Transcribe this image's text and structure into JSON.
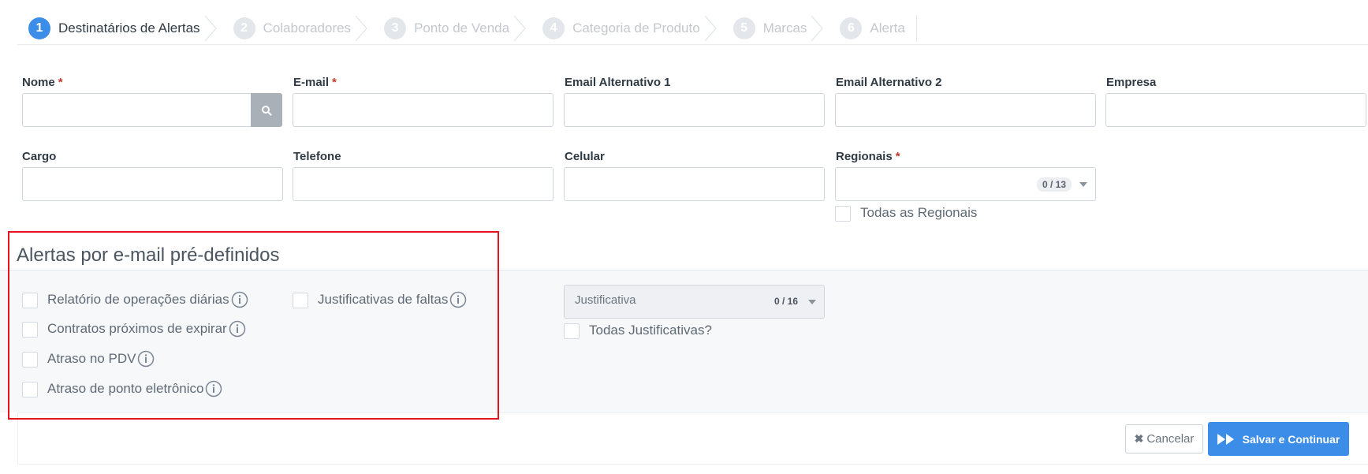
{
  "wizard": {
    "steps": [
      {
        "num": "1",
        "label": "Destinatários de Alertas"
      },
      {
        "num": "2",
        "label": "Colaboradores"
      },
      {
        "num": "3",
        "label": "Ponto de Venda"
      },
      {
        "num": "4",
        "label": "Categoria de Produto"
      },
      {
        "num": "5",
        "label": "Marcas"
      },
      {
        "num": "6",
        "label": "Alerta"
      }
    ],
    "active_step": "1"
  },
  "form": {
    "nome_label": "Nome",
    "email_label": "E-mail",
    "email_alt1_label": "Email Alternativo 1",
    "email_alt2_label": "Email Alternativo 2",
    "empresa_label": "Empresa",
    "cargo_label": "Cargo",
    "telefone_label": "Telefone",
    "celular_label": "Celular",
    "regionais_label": "Regionais",
    "regionais_count": "0 / 13",
    "todas_regionais_label": "Todas as Regionais",
    "required_mark": "*"
  },
  "alerts_section": {
    "title": "Alertas por e-mail pré-definidos",
    "items": [
      {
        "label": "Relatório de operações diárias"
      },
      {
        "label": "Contratos próximos de expirar"
      },
      {
        "label": "Atraso no PDV"
      },
      {
        "label": "Atraso de ponto eletrônico"
      },
      {
        "label": "Justificativas de faltas"
      }
    ],
    "justificativa_placeholder": "Justificativa",
    "justificativa_count": "0 / 16",
    "todas_justificativas_label": "Todas Justificativas?"
  },
  "footer": {
    "cancel_label": "Cancelar",
    "save_label": "Salvar e Continuar"
  },
  "colors": {
    "accent": "#3b8de8",
    "required": "#c0392b",
    "highlight_box": "#e5141c"
  }
}
